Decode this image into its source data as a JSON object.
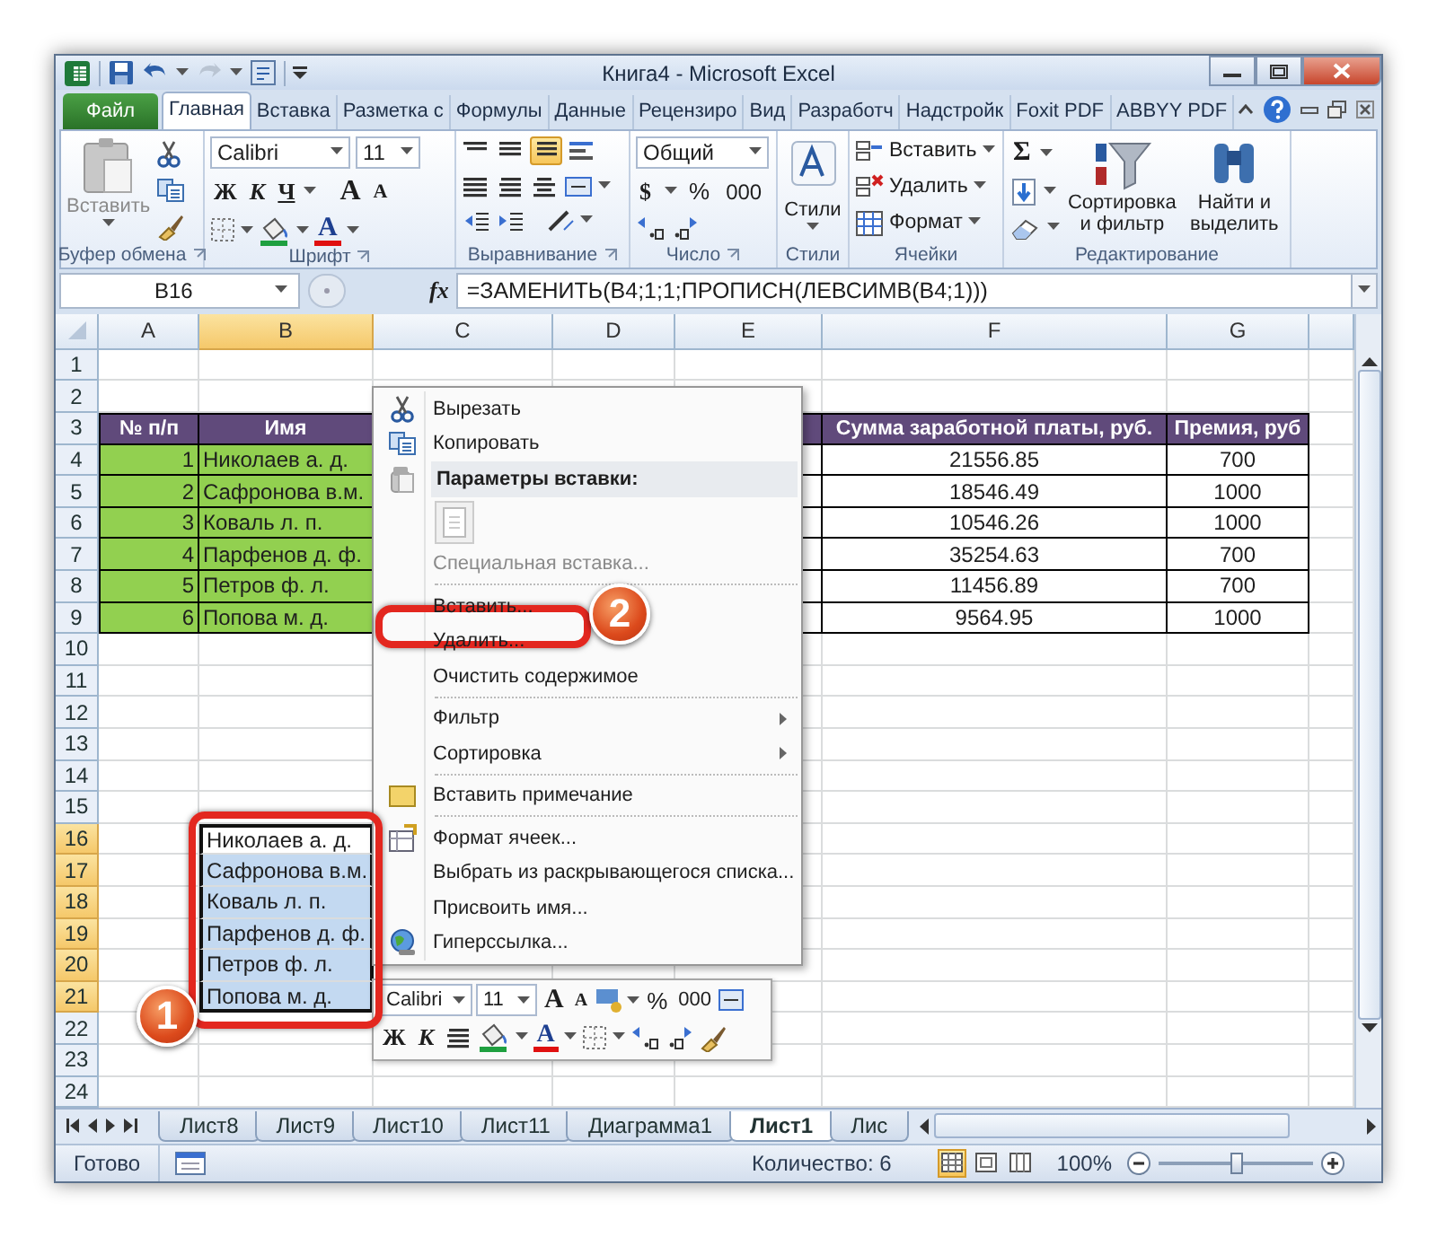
{
  "window": {
    "title": "Книга4 - Microsoft Excel"
  },
  "file_tab": {
    "label": "Файл"
  },
  "tabs": [
    {
      "label": "Главная",
      "selected": true
    },
    {
      "label": "Вставка",
      "selected": false
    },
    {
      "label": "Разметка с",
      "selected": false
    },
    {
      "label": "Формулы",
      "selected": false
    },
    {
      "label": "Данные",
      "selected": false
    },
    {
      "label": "Рецензиро",
      "selected": false
    },
    {
      "label": "Вид",
      "selected": false
    },
    {
      "label": "Разработч",
      "selected": false
    },
    {
      "label": "Надстройк",
      "selected": false
    },
    {
      "label": "Foxit PDF",
      "selected": false
    },
    {
      "label": "ABBYY PDF",
      "selected": false
    }
  ],
  "ribbon": {
    "clipboard": {
      "label": "Буфер обмена",
      "paste": "Вставить"
    },
    "font": {
      "label": "Шрифт",
      "font": "Calibri",
      "size": "11",
      "bold": "Ж",
      "italic": "К",
      "underline": "Ч",
      "grow": "A",
      "shrink": "A",
      "color_letter": "A"
    },
    "alignment": {
      "label": "Выравнивание"
    },
    "number": {
      "label": "Число",
      "format": "Общий",
      "currency": "$",
      "percent": "%",
      "thousands": "000"
    },
    "styles": {
      "label": "Стили",
      "button": "Стили"
    },
    "cells": {
      "label": "Ячейки",
      "items": [
        "Вставить",
        "Удалить",
        "Формат"
      ]
    },
    "editing": {
      "label": "Редактирование",
      "autosum": "Σ",
      "sort": "Сортировка и фильтр",
      "find": "Найти и выделить"
    }
  },
  "formula_bar": {
    "name_box": "B16",
    "fx": "fx",
    "formula": "=ЗАМЕНИТЬ(B4;1;1;ПРОПИСН(ЛЕВСИМВ(B4;1)))"
  },
  "sheet": {
    "columns": [
      {
        "label": "A",
        "selected": false
      },
      {
        "label": "B",
        "selected": true
      },
      {
        "label": "C",
        "selected": false
      },
      {
        "label": "D",
        "selected": false
      },
      {
        "label": "E",
        "selected": false
      },
      {
        "label": "F",
        "selected": false
      },
      {
        "label": "G",
        "selected": false
      }
    ],
    "rows": [
      {
        "number": "1",
        "selected": false,
        "kind": "empty"
      },
      {
        "number": "2",
        "selected": false,
        "kind": "empty"
      },
      {
        "number": "3",
        "selected": false,
        "kind": "table-header",
        "cells": [
          {
            "text": "№ п/п"
          },
          {
            "text": "Имя"
          },
          {
            "text": "Сумма заработной платы, руб."
          },
          {
            "text": "Премия, руб"
          }
        ]
      },
      {
        "number": "4",
        "selected": false,
        "kind": "table-row",
        "cells": [
          {
            "text": "1"
          },
          {
            "text": "Николаев а. д."
          },
          {
            "text": "21556.85"
          },
          {
            "text": "700"
          }
        ]
      },
      {
        "number": "5",
        "selected": false,
        "kind": "table-row",
        "cells": [
          {
            "text": "2"
          },
          {
            "text": "Сафронова в.м."
          },
          {
            "text": "18546.49"
          },
          {
            "text": "1000"
          }
        ]
      },
      {
        "number": "6",
        "selected": false,
        "kind": "table-row",
        "cells": [
          {
            "text": "3"
          },
          {
            "text": "Коваль л. п."
          },
          {
            "text": "10546.26"
          },
          {
            "text": "1000"
          }
        ]
      },
      {
        "number": "7",
        "selected": false,
        "kind": "table-row",
        "cells": [
          {
            "text": "4"
          },
          {
            "text": "Парфенов д. ф."
          },
          {
            "text": "35254.63"
          },
          {
            "text": "700"
          }
        ]
      },
      {
        "number": "8",
        "selected": false,
        "kind": "table-row",
        "cells": [
          {
            "text": "5"
          },
          {
            "text": "Петров ф. л."
          },
          {
            "text": "11456.89"
          },
          {
            "text": "700"
          }
        ]
      },
      {
        "number": "9",
        "selected": false,
        "kind": "table-row",
        "cells": [
          {
            "text": "6"
          },
          {
            "text": "Попова м. д."
          },
          {
            "text": "9564.95"
          },
          {
            "text": "1000"
          }
        ]
      },
      {
        "number": "10",
        "selected": false,
        "kind": "empty"
      },
      {
        "number": "11",
        "selected": false,
        "kind": "empty"
      },
      {
        "number": "12",
        "selected": false,
        "kind": "empty"
      },
      {
        "number": "13",
        "selected": false,
        "kind": "empty"
      },
      {
        "number": "14",
        "selected": false,
        "kind": "empty"
      },
      {
        "number": "15",
        "selected": false,
        "kind": "empty"
      },
      {
        "number": "16",
        "selected": true,
        "kind": "copy",
        "cells": [
          {
            "text": "Николаев а. д.",
            "selected": true,
            "active": true
          }
        ]
      },
      {
        "number": "17",
        "selected": true,
        "kind": "copy",
        "cells": [
          {
            "text": "Сафронова в.м.",
            "selected": true,
            "active": false
          }
        ]
      },
      {
        "number": "18",
        "selected": true,
        "kind": "copy",
        "cells": [
          {
            "text": "Коваль л. п.",
            "selected": true,
            "active": false
          }
        ]
      },
      {
        "number": "19",
        "selected": true,
        "kind": "copy",
        "cells": [
          {
            "text": "Парфенов д. ф.",
            "selected": true,
            "active": false
          }
        ]
      },
      {
        "number": "20",
        "selected": true,
        "kind": "copy",
        "cells": [
          {
            "text": "Петров ф. л.",
            "selected": true,
            "active": false
          }
        ]
      },
      {
        "number": "21",
        "selected": true,
        "kind": "copy",
        "cells": [
          {
            "text": "Попова м. д.",
            "selected": true,
            "active": false
          }
        ]
      },
      {
        "number": "22",
        "selected": false,
        "kind": "empty"
      },
      {
        "number": "23",
        "selected": false,
        "kind": "empty"
      },
      {
        "number": "24",
        "selected": false,
        "kind": "empty"
      }
    ]
  },
  "context_menu": [
    {
      "kind": "cut",
      "label": "Вырезать"
    },
    {
      "kind": "copy",
      "label": "Копировать"
    },
    {
      "kind": "header",
      "label": "Параметры вставки:"
    },
    {
      "kind": "paste-options"
    },
    {
      "kind": "disabled",
      "label": "Специальная вставка..."
    },
    {
      "kind": "separator"
    },
    {
      "kind": "item",
      "label": "Вставить..."
    },
    {
      "kind": "item",
      "label": "Удалить..."
    },
    {
      "kind": "item",
      "label": "Очистить содержимое"
    },
    {
      "kind": "separator"
    },
    {
      "kind": "submenu",
      "label": "Фильтр"
    },
    {
      "kind": "submenu",
      "label": "Сортировка"
    },
    {
      "kind": "separator"
    },
    {
      "kind": "comment",
      "label": "Вставить примечание"
    },
    {
      "kind": "separator"
    },
    {
      "kind": "format",
      "label": "Формат ячеек..."
    },
    {
      "kind": "item",
      "label": "Выбрать из раскрывающегося списка..."
    },
    {
      "kind": "item",
      "label": "Присвоить имя..."
    },
    {
      "kind": "hyperlink",
      "label": "Гиперссылка..."
    }
  ],
  "mini_toolbar": {
    "font": "Calibri",
    "size": "11",
    "grow": "A",
    "shrink": "A",
    "percent": "%",
    "thousands": "000",
    "bold": "Ж",
    "italic": "К",
    "color_letter": "A"
  },
  "callouts": [
    {
      "kind": "range",
      "label": "1"
    },
    {
      "kind": "menu-item",
      "label": "2"
    }
  ],
  "sheet_tabs": [
    {
      "label": "Лист8",
      "selected": false
    },
    {
      "label": "Лист9",
      "selected": false
    },
    {
      "label": "Лист10",
      "selected": false
    },
    {
      "label": "Лист11",
      "selected": false
    },
    {
      "label": "Диаграмма1",
      "selected": false
    },
    {
      "label": "Лист1",
      "selected": true
    },
    {
      "label": "Лис",
      "selected": false
    }
  ],
  "status_bar": {
    "status": "Готово",
    "count": "Количество: 6",
    "views": [
      {
        "kind": "normal",
        "selected": true
      },
      {
        "kind": "layout",
        "selected": false
      },
      {
        "kind": "page-break",
        "selected": false
      }
    ],
    "zoom": "100%",
    "zoom_slider": {
      "level": 0.5
    }
  }
}
